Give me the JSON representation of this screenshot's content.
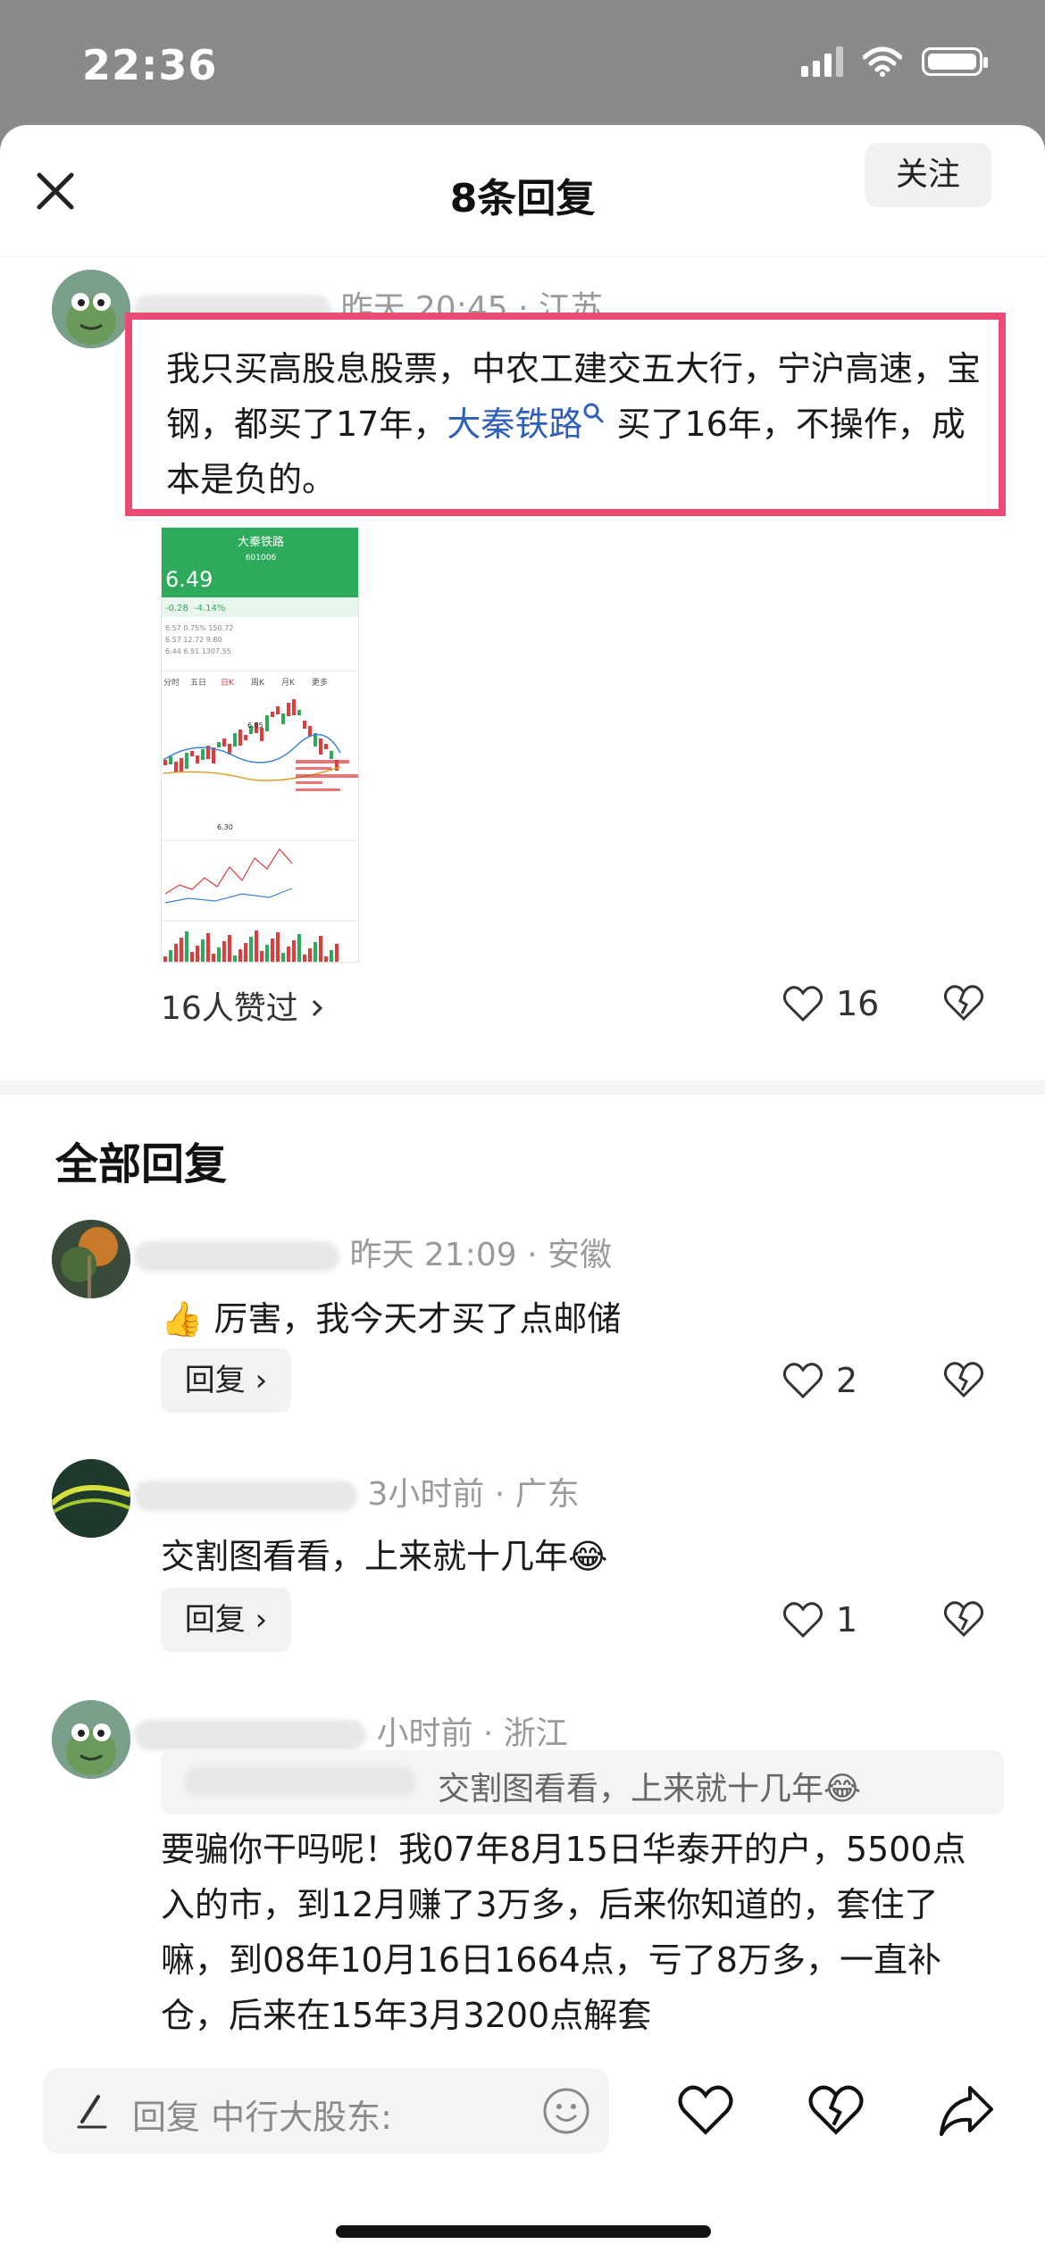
{
  "status_bar": {
    "time": "22:36"
  },
  "header": {
    "title": "8条回复"
  },
  "original_comment": {
    "meta": "昨天 20:45 · 江苏",
    "follow_label": "关注",
    "text_part1": "我只买高股息股票，中农工建交五大行，宁沪高速，宝钢，都买了17年，",
    "link_text": "大秦铁路",
    "text_part2": " 买了16年，不操作，成本是负的。",
    "liked_by": "16人赞过",
    "like_count": "16",
    "stock_image": {
      "name": "大秦铁路",
      "code": "601006",
      "price": "6.49",
      "change": "-0.28",
      "change_pct": "-4.14%",
      "tabs": [
        "分时",
        "五日",
        "日K",
        "周K",
        "月K",
        "更多"
      ],
      "high_label": "6.85",
      "low_label": "6.30"
    }
  },
  "section_title": "全部回复",
  "replies": [
    {
      "meta": "昨天 21:09 · 安徽",
      "text": "👍 厉害，我今天才买了点邮储",
      "reply_label": "回复 ›",
      "like_count": "2"
    },
    {
      "meta": "3小时前 · 广东",
      "text": "交割图看看，上来就十几年😂",
      "reply_label": "回复 ›",
      "like_count": "1"
    },
    {
      "meta": "小时前 · 浙江",
      "quote": "交割图看看，上来就十几年😂",
      "text": "要骗你干吗呢！我07年8月15日华泰开的户，5500点入的市，到12月赚了3万多，后来你知道的，套住了嘛，到08年10月16日1664点，亏了8万多，一直补仓，后来在15年3月3200点解套"
    }
  ],
  "bottom_bar": {
    "input_label": "回复 中行大股东:"
  },
  "colors": {
    "highlight": "#ea4a73",
    "link": "#2f5fb8",
    "stock_green": "#2eaa5c"
  }
}
